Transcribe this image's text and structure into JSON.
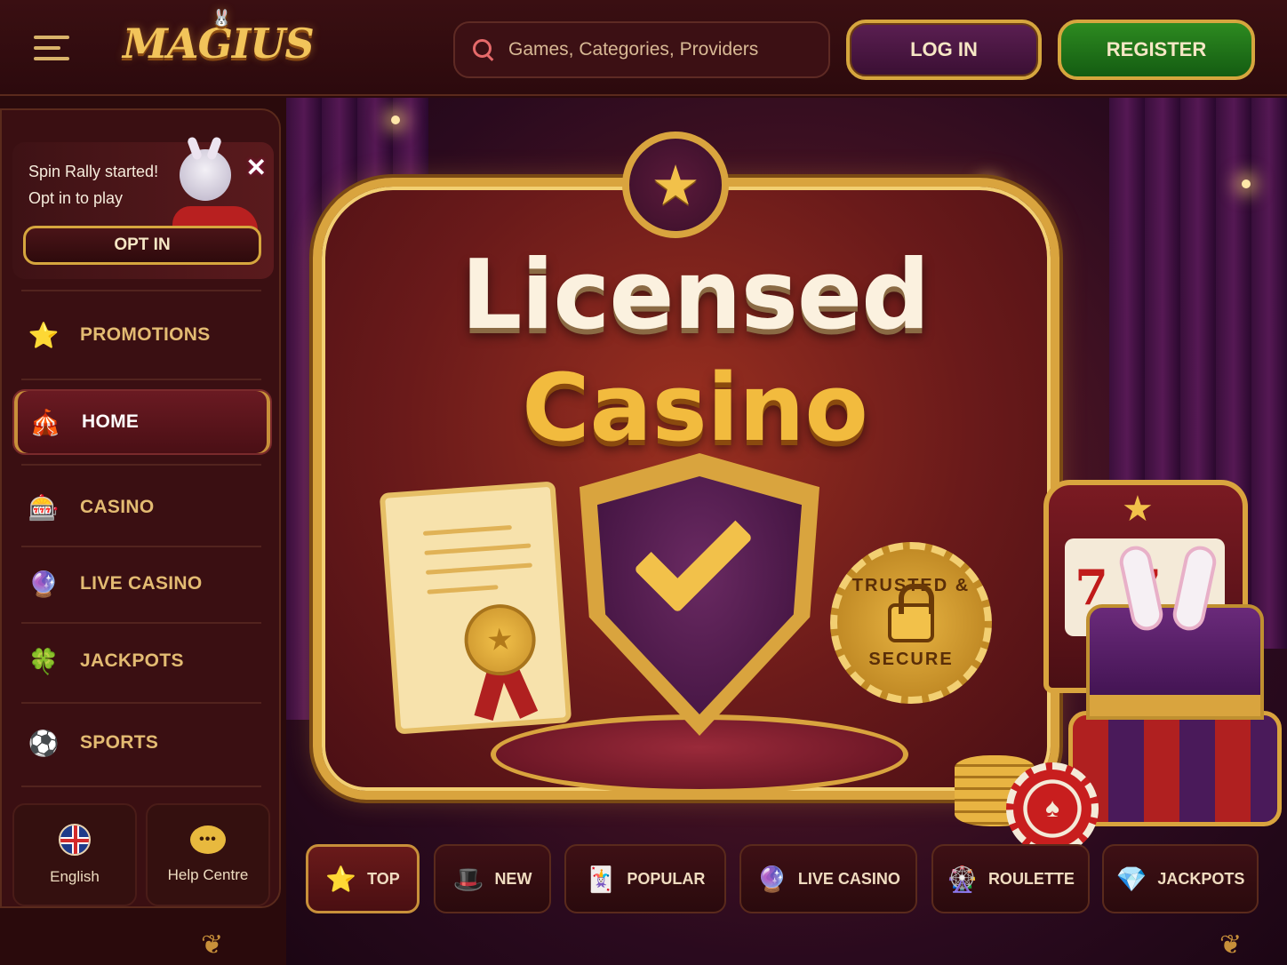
{
  "header": {
    "logo_text": "MAGIUS",
    "search_placeholder": "Games, Categories, Providers",
    "login_label": "LOG IN",
    "register_label": "REGISTER"
  },
  "promo": {
    "line1": "Spin Rally started!",
    "line2": "Opt in to play",
    "optin_label": "OPT IN",
    "close_glyph": "✕"
  },
  "sidebar": {
    "items": [
      {
        "label": "PROMOTIONS",
        "icon": "jack-in-box-icon",
        "glyph": "⭐"
      },
      {
        "label": "HOME",
        "icon": "circus-tent-icon",
        "glyph": "🎪",
        "active": true
      },
      {
        "label": "CASINO",
        "icon": "slot-777-icon",
        "glyph": "🎰"
      },
      {
        "label": "LIVE CASINO",
        "icon": "crystal-ball-icon",
        "glyph": "🔮"
      },
      {
        "label": "JACKPOTS",
        "icon": "jackpot-777-icon",
        "glyph": "🍀"
      },
      {
        "label": "SPORTS",
        "icon": "football-trophy-icon",
        "glyph": "⚽"
      }
    ],
    "language_label": "English",
    "help_label": "Help Centre"
  },
  "hero": {
    "title_line1": "Licensed",
    "title_line2": "Casino",
    "seal_top": "TRUSTED &",
    "seal_bottom": "SECURE",
    "slot_reels": [
      "7",
      "7",
      "7"
    ]
  },
  "categories": [
    {
      "label": "TOP",
      "icon": "star-box-icon",
      "glyph": "⭐",
      "active": true
    },
    {
      "label": "NEW",
      "icon": "magic-hat-icon",
      "glyph": "🎩"
    },
    {
      "label": "POPULAR",
      "icon": "jester-hat-icon",
      "glyph": "🃏"
    },
    {
      "label": "LIVE CASINO",
      "icon": "crystal-ball-icon",
      "glyph": "🔮"
    },
    {
      "label": "ROULETTE",
      "icon": "roulette-icon",
      "glyph": "🎡"
    },
    {
      "label": "JACKPOTS",
      "icon": "diamond-icon",
      "glyph": "💎"
    }
  ],
  "colors": {
    "accent_gold": "#d9a43e",
    "bg_dark": "#2a0a0c",
    "register_green": "#2d8a20",
    "login_purple": "#5b1f52"
  }
}
